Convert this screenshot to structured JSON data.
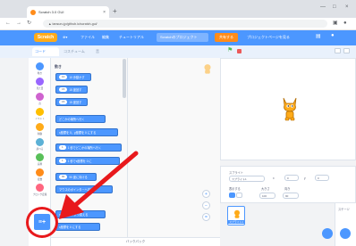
{
  "browser": {
    "tab_title": "Scratch 3.0 GUI",
    "tab_close": "×",
    "new_tab": "+",
    "url": "▲ tansuru.jp/github.io/scratch-gui/",
    "win_buttons": [
      "—",
      "□",
      "×"
    ]
  },
  "menu": {
    "logo": "Scratch",
    "items": [
      "ファイル",
      "編集",
      "チュートリアル"
    ],
    "project_title": "Scratchのプロジェクト",
    "share": "共有する",
    "see_project": "プロジェクトページを見る"
  },
  "editor_tabs": [
    "コード",
    "コスチューム",
    "音"
  ],
  "categories": [
    {
      "label": "動き",
      "color": "#4c97ff"
    },
    {
      "label": "見た目",
      "color": "#9966ff"
    },
    {
      "label": "音",
      "color": "#cf63cf"
    },
    {
      "label": "イベント",
      "color": "#ffbf00"
    },
    {
      "label": "制御",
      "color": "#ffab19"
    },
    {
      "label": "調べる",
      "color": "#5cb1d6"
    },
    {
      "label": "演算",
      "color": "#59c059"
    },
    {
      "label": "変数",
      "color": "#ff8c1a"
    },
    {
      "label": "ブロック定義",
      "color": "#ff6680"
    }
  ],
  "palette": {
    "title": "動き",
    "blocks": [
      {
        "text": "10 歩動かす",
        "pill": "10"
      },
      {
        "text": "15 度回す",
        "pill": "15"
      },
      {
        "text": "15 度回す",
        "pill": "15"
      },
      {
        "text": "どこかの場所へ行く",
        "pill": ""
      },
      {
        "text": "x座標を 0、y座標を 0 にする",
        "pill": "0"
      },
      {
        "text": "1 秒でどこかの場所へ行く",
        "pill": "1"
      },
      {
        "text": "1 秒でx座標を 0 に",
        "pill": "1"
      },
      {
        "text": "90 度に向ける",
        "pill": "90"
      },
      {
        "text": "マウスのポインターへ向ける",
        "pill": ""
      },
      {
        "text": "x座標を 10 ずつ変える",
        "pill": "10"
      },
      {
        "text": "x座標を 0 にする",
        "pill": "0"
      }
    ]
  },
  "zoom": [
    "+",
    "−",
    "="
  ],
  "backpack": "バックパック",
  "sprite_info": {
    "sprite_label": "スプライト",
    "sprite_name": "スプライト1",
    "x_label": "x",
    "x_value": "0",
    "y_label": "y",
    "y_value": "0",
    "show_label": "表示する",
    "size_label": "大きさ",
    "size_value": "100",
    "direction_label": "向き",
    "direction_value": "90"
  },
  "sprite_tile": {
    "name": "スプライト1"
  },
  "stage_pane": {
    "label": "ステージ"
  },
  "extension_button": {
    "glyph": "≡+"
  },
  "colors": {
    "accent": "#4c97ff",
    "annotation": "#e8191c"
  }
}
